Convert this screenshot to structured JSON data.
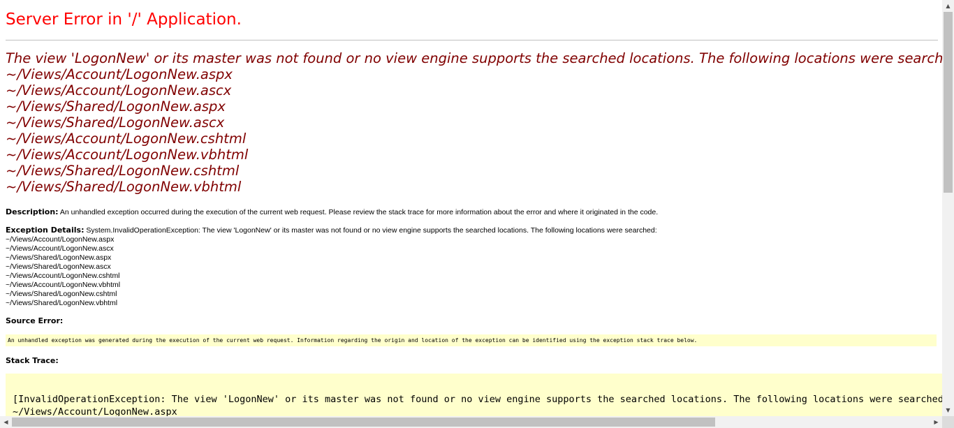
{
  "title": "Server Error in '/' Application.",
  "error_heading": [
    "The view 'LogonNew' or its master was not found or no view engine supports the searched locations. The following locations were searched:",
    "~/Views/Account/LogonNew.aspx",
    "~/Views/Account/LogonNew.ascx",
    "~/Views/Shared/LogonNew.aspx",
    "~/Views/Shared/LogonNew.ascx",
    "~/Views/Account/LogonNew.cshtml",
    "~/Views/Account/LogonNew.vbhtml",
    "~/Views/Shared/LogonNew.cshtml",
    "~/Views/Shared/LogonNew.vbhtml"
  ],
  "description": {
    "label": "Description:",
    "text": "An unhandled exception occurred during the execution of the current web request. Please review the stack trace for more information about the error and where it originated in the code."
  },
  "exception_details": {
    "label": "Exception Details:",
    "lines": [
      "System.InvalidOperationException: The view 'LogonNew' or its master was not found or no view engine supports the searched locations. The following locations were searched:",
      "~/Views/Account/LogonNew.aspx",
      "~/Views/Account/LogonNew.ascx",
      "~/Views/Shared/LogonNew.aspx",
      "~/Views/Shared/LogonNew.ascx",
      "~/Views/Account/LogonNew.cshtml",
      "~/Views/Account/LogonNew.vbhtml",
      "~/Views/Shared/LogonNew.cshtml",
      "~/Views/Shared/LogonNew.vbhtml"
    ]
  },
  "source_error": {
    "label": "Source Error:",
    "text": "An unhandled exception was generated during the execution of the current web request. Information regarding the origin and location of the exception can be identified using the exception stack trace below."
  },
  "stack_trace": {
    "label": "Stack Trace:",
    "lines": [
      "[InvalidOperationException: The view 'LogonNew' or its master was not found or no view engine supports the searched locations. The following locations were searched:",
      "~/Views/Account/LogonNew.aspx"
    ]
  },
  "scrollbars": {
    "up_arrow_icon": "triangle-up",
    "down_arrow_icon": "triangle-down",
    "left_arrow_icon": "triangle-left",
    "right_arrow_icon": "triangle-right"
  },
  "colors": {
    "title": "#ff0000",
    "heading": "#800000",
    "code_background": "#ffffcc"
  }
}
